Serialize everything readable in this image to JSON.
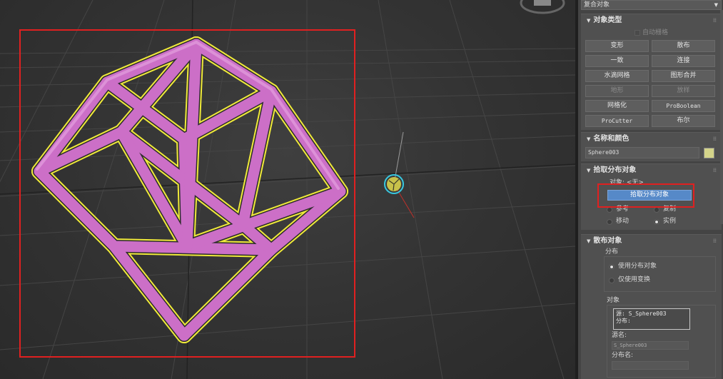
{
  "panel": {
    "category_dropdown": "复合对象",
    "object_type": {
      "title": "对象类型",
      "auto_grid": "自动栅格",
      "buttons": [
        {
          "label": "变形",
          "enabled": true,
          "mono": false
        },
        {
          "label": "散布",
          "enabled": true,
          "mono": false
        },
        {
          "label": "一致",
          "enabled": true,
          "mono": false
        },
        {
          "label": "连接",
          "enabled": true,
          "mono": false
        },
        {
          "label": "水滴网格",
          "enabled": true,
          "mono": false
        },
        {
          "label": "图形合并",
          "enabled": true,
          "mono": false
        },
        {
          "label": "地形",
          "enabled": false,
          "mono": false
        },
        {
          "label": "放样",
          "enabled": false,
          "mono": false
        },
        {
          "label": "网格化",
          "enabled": true,
          "mono": false
        },
        {
          "label": "ProBoolean",
          "enabled": true,
          "mono": true
        },
        {
          "label": "ProCutter",
          "enabled": true,
          "mono": true
        },
        {
          "label": "布尔",
          "enabled": true,
          "mono": false
        }
      ]
    },
    "name_color": {
      "title": "名称和颜色",
      "name_value": "Sphere003",
      "swatch_color": "#d4d48a"
    },
    "pick_distribution": {
      "title": "拾取分布对象",
      "object_label": "对象: <无>",
      "pick_button": "拾取分布对象",
      "radios": [
        {
          "label": "参考",
          "checked": false
        },
        {
          "label": "复制",
          "checked": false
        },
        {
          "label": "移动",
          "checked": false
        },
        {
          "label": "实例",
          "checked": true
        }
      ]
    },
    "scatter_objects": {
      "title": "散布对象",
      "distribution_group": "分布",
      "distribution_options": [
        {
          "label": "使用分布对象",
          "checked": true
        },
        {
          "label": "仅使用变换",
          "checked": false
        }
      ],
      "objects_group": "对象",
      "source_line": "源: S_Sphere003",
      "dist_line": "分布:",
      "source_name_label": "源名:",
      "source_name_value": "S_Sphere003",
      "dist_name_label": "分布名:",
      "dist_name_value": ""
    }
  },
  "colors": {
    "lattice": "#cc6fc7",
    "selection_outline": "#f0ea3a",
    "highlight_red": "#e02020",
    "pick_button": "#5689c8"
  }
}
